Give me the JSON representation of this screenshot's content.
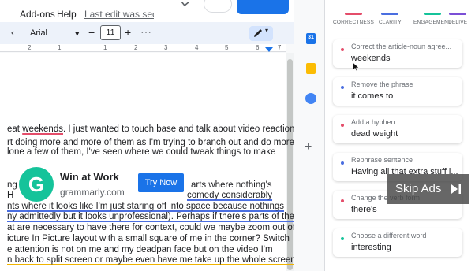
{
  "menubar": {
    "addons": "Add-ons",
    "help": "Help",
    "last_edit": "Last edit was second"
  },
  "toolbar": {
    "font": "Arial",
    "font_size": "11",
    "minus": "−",
    "plus": "+",
    "more": "⋮",
    "chevron": "‹"
  },
  "ruler": {
    "numbers": [
      "2",
      "1",
      "1",
      "2",
      "3",
      "4",
      "5",
      "6",
      "7"
    ]
  },
  "document": {
    "lines": [
      [
        "eat ",
        "weekends",
        ". I just wanted to touch base and talk about video reactions."
      ],
      [
        "rt doing more and more of them as I'm trying to branch out and do more"
      ],
      [
        "lone a few of them, I've seen where we could tweak things to make"
      ],
      [
        "ng",
        "arts where nothing's"
      ],
      [
        "H",
        "comedy considerably"
      ],
      [
        "nts where it looks like I'm just staring off into space because nothings"
      ],
      [
        "ny admittedly but it looks unprofessional). Perhaps if there's parts of the"
      ],
      [
        "at are necessary to have there for context, could we maybe zoom out of"
      ],
      [
        "icture In Picture layout with a small square of me in the corner? Switch"
      ],
      [
        "e attention is not on me and my deadpan face but on the video I'm"
      ],
      [
        "n back to split screen or maybe even have me take up the whole screen"
      ]
    ]
  },
  "ad": {
    "title": "Win at Work",
    "domain": "grammarly.com",
    "cta": "Try Now"
  },
  "grammarly": {
    "categories": [
      {
        "label": "CORRECTNESS",
        "color": "#e44d6a"
      },
      {
        "label": "CLARITY",
        "color": "#4a6ee0"
      },
      {
        "label": "ENGAGEMENT",
        "color": "#15c39a"
      },
      {
        "label": "DELIVE",
        "color": "#7b4fd6"
      }
    ],
    "cards": [
      {
        "title": "Correct the article-noun agree...",
        "value": "weekends",
        "dot": "#e44d6a"
      },
      {
        "title": "Remove the phrase",
        "value": "it comes to",
        "dot": "#4a6ee0"
      },
      {
        "title": "Add a hyphen",
        "value": "dead weight",
        "dot": "#e44d6a"
      },
      {
        "title": "Rephrase sentence",
        "value": "Having all that extra stuff i...",
        "dot": "#4a6ee0"
      },
      {
        "title": "Change the verb form",
        "value": "there's",
        "dot": "#e44d6a"
      },
      {
        "title": "Choose a different word",
        "value": "interesting",
        "dot": "#15c39a"
      }
    ]
  },
  "skip_ads": "Skip Ads",
  "colors": {
    "accent": "#1a73e8",
    "grammarly_green": "#15c39a"
  },
  "icons": [
    "search-icon",
    "comment-icon",
    "pen-icon",
    "calendar-icon",
    "keep-icon",
    "tasks-icon",
    "plus-icon",
    "skip-icon",
    "cursor-icon"
  ]
}
